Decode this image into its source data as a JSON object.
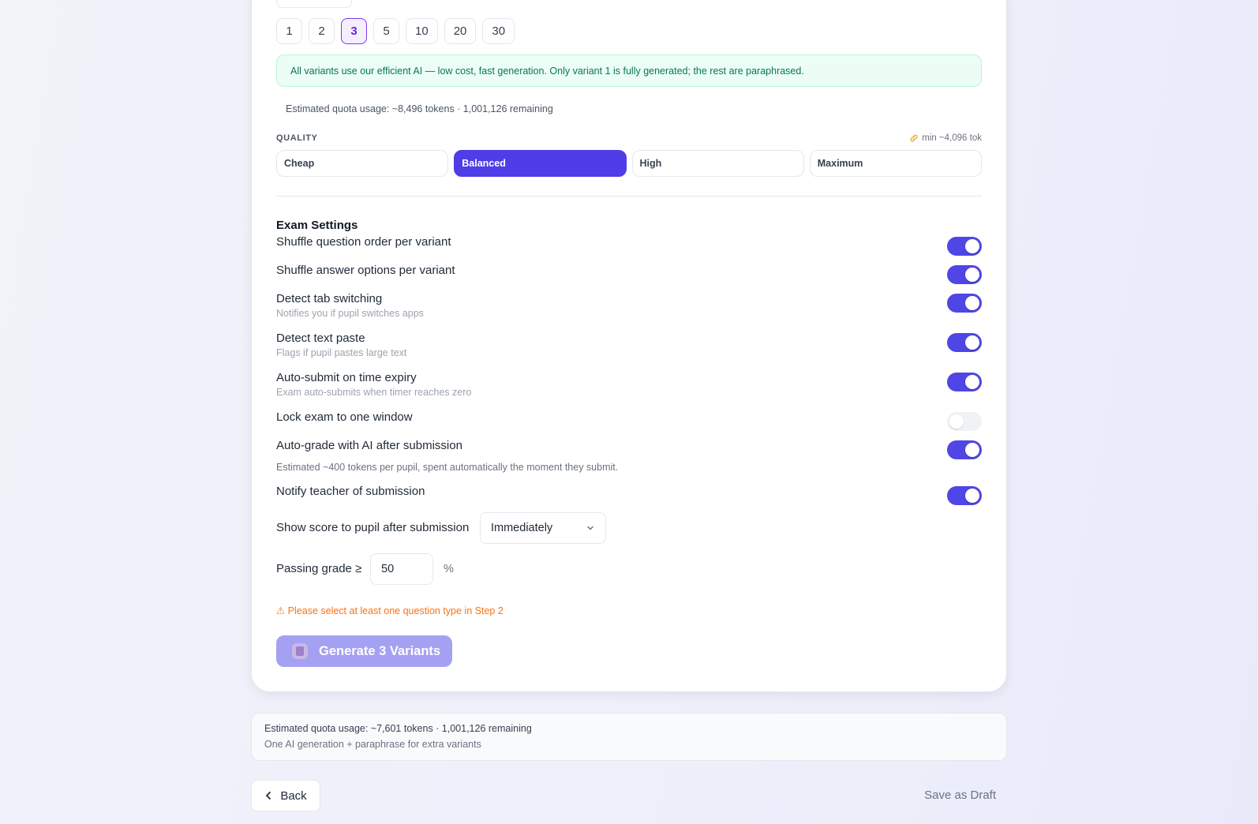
{
  "variant_counts": {
    "options": [
      "1",
      "2",
      "3",
      "5",
      "10",
      "20",
      "30"
    ],
    "selected": "3"
  },
  "info_message": "All variants use our efficient AI — low cost, fast generation. Only variant 1 is fully generated; the rest are paraphrased.",
  "estimate_top": "Estimated quota usage: ~8,496 tokens · 1,001,126 remaining",
  "quality": {
    "label": "QUALITY",
    "min_tokens": "min ~4,096 tok",
    "options": [
      "Cheap",
      "Balanced",
      "High",
      "Maximum"
    ],
    "selected": "Balanced"
  },
  "exam_settings": {
    "title": "Exam Settings",
    "items": [
      {
        "label": "Shuffle question order per variant",
        "sub": "",
        "on": true
      },
      {
        "label": "Shuffle answer options per variant",
        "sub": "",
        "on": true
      },
      {
        "label": "Detect tab switching",
        "sub": "Notifies you if pupil switches apps",
        "on": true
      },
      {
        "label": "Detect text paste",
        "sub": "Flags if pupil pastes large text",
        "on": true
      },
      {
        "label": "Auto-submit on time expiry",
        "sub": "Exam auto-submits when timer reaches zero",
        "on": true
      },
      {
        "label": "Lock exam to one window",
        "sub": "",
        "on": false
      },
      {
        "label": "Auto-grade with AI after submission",
        "sub": "",
        "on": true
      },
      {
        "label": "Notify teacher of submission",
        "sub": "",
        "on": true
      }
    ],
    "auto_grade_note": "Estimated ~400 tokens per pupil, spent automatically the moment they submit.",
    "show_score_label": "Show score to pupil after submission",
    "show_score_value": "Immediately",
    "passing_grade_label": "Passing grade ≥",
    "passing_grade_value": "50",
    "passing_grade_unit": "%"
  },
  "warning": "⚠ Please select at least one question type in Step 2",
  "generate_button": "Generate 3 Variants",
  "quota_summary": {
    "line1": "Estimated quota usage: ~7,601 tokens · 1,001,126 remaining",
    "line2": "One AI generation + paraphrase for extra variants"
  },
  "footer": {
    "back_label": "Back",
    "draft_label": "Save as Draft"
  },
  "colors": {
    "accent": "#4f46e5",
    "success_bg": "#ecfdf5",
    "success_text": "#047857",
    "warning": "#f97316"
  }
}
